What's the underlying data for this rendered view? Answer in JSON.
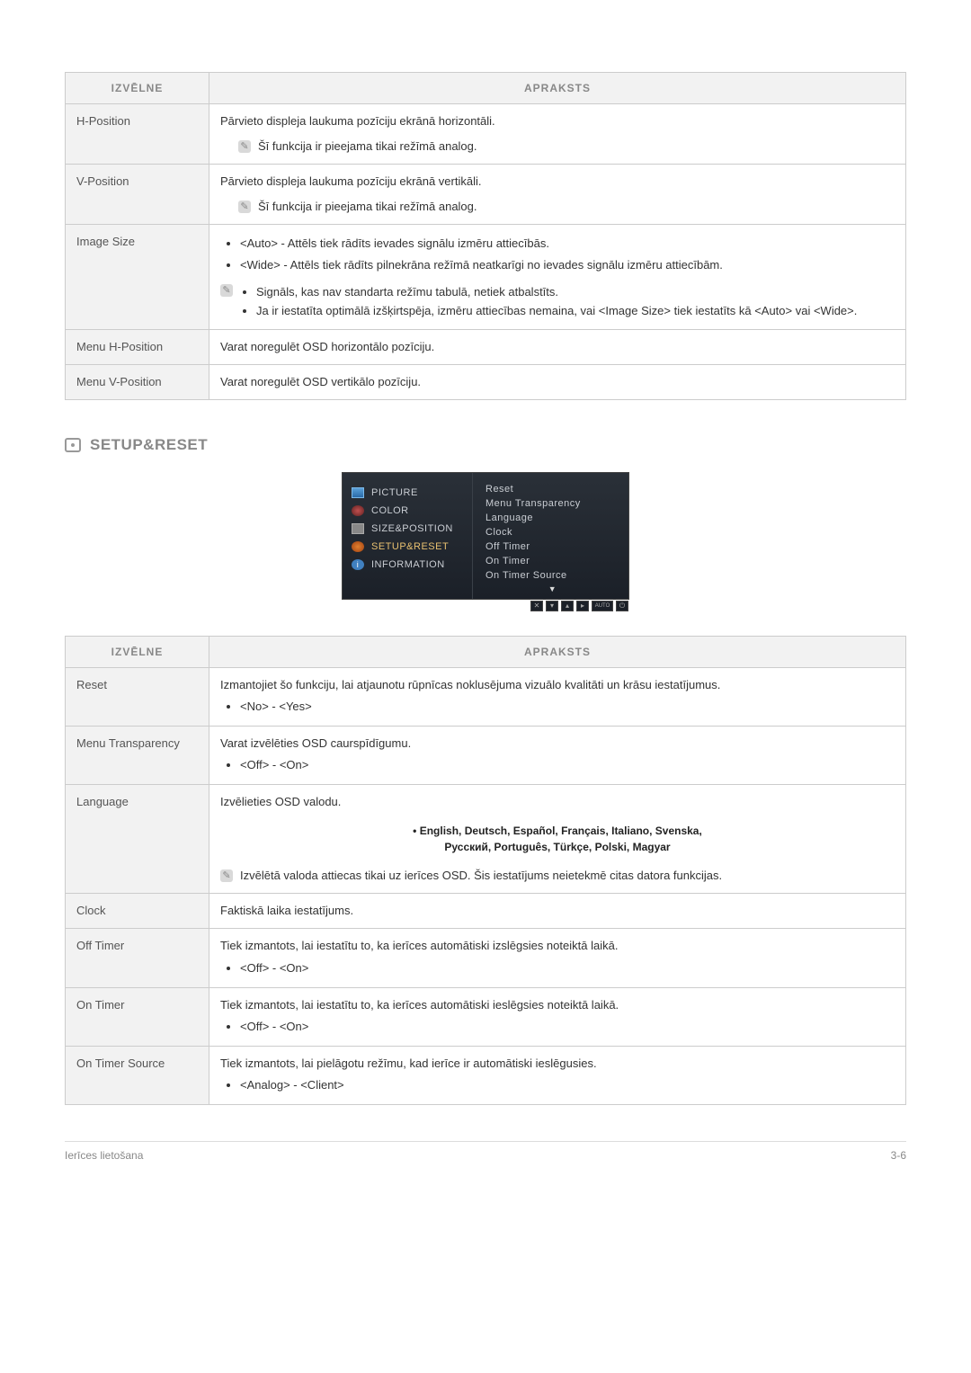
{
  "headers": {
    "menu": "IZVĒLNE",
    "desc": "APRAKSTS"
  },
  "table1": {
    "hposition": {
      "name": "H-Position",
      "desc": "Pārvieto displeja laukuma pozīciju ekrānā horizontāli.",
      "note": "Šī funkcija ir pieejama tikai režīmā analog."
    },
    "vposition": {
      "name": "V-Position",
      "desc": "Pārvieto displeja laukuma pozīciju ekrānā vertikāli.",
      "note": "Šī funkcija ir pieejama tikai režīmā analog."
    },
    "imagesize": {
      "name": "Image Size",
      "b1": "<Auto> - Attēls tiek rādīts ievades signālu izmēru attiecībās.",
      "b2": "<Wide> - Attēls tiek rādīts pilnekrāna režīmā neatkarīgi no ievades signālu izmēru attiecībām.",
      "n1": "Signāls, kas nav standarta režīmu tabulā, netiek atbalstīts.",
      "n2": "Ja ir iestatīta optimālā izšķirtspēja, izmēru attiecības nemaina, vai <Image Size> tiek iestatīts kā <Auto> vai <Wide>."
    },
    "menuH": {
      "name": "Menu H-Position",
      "desc": "Varat noregulēt OSD horizontālo pozīciju."
    },
    "menuV": {
      "name": "Menu V-Position",
      "desc": "Varat noregulēt OSD vertikālo pozīciju."
    }
  },
  "section": {
    "title": "SETUP&RESET"
  },
  "osd": {
    "left": {
      "picture": "PICTURE",
      "color": "COLOR",
      "size": "SIZE&POSITION",
      "setup": "SETUP&RESET",
      "info": "INFORMATION"
    },
    "right": {
      "reset": "Reset",
      "mtrans": "Menu Transparency",
      "lang": "Language",
      "clock": "Clock",
      "offt": "Off Timer",
      "ont": "On Timer",
      "onts": "On Timer Source"
    },
    "bottom": [
      "✕",
      "▾",
      "▴",
      "▸",
      "AUTO",
      "⏻"
    ]
  },
  "table2": {
    "reset": {
      "name": "Reset",
      "desc": "Izmantojiet šo funkciju, lai atjaunotu rūpnīcas noklusējuma vizuālo kvalitāti un krāsu iestatījumus.",
      "opt": "<No> - <Yes>"
    },
    "mtrans": {
      "name": "Menu Transparency",
      "desc": "Varat izvēlēties OSD caurspīdīgumu.",
      "opt": "<Off> - <On>"
    },
    "lang": {
      "name": "Language",
      "desc": "Izvēlieties OSD valodu.",
      "langs1": "English, Deutsch, Español, Français, Italiano, Svenska,",
      "langs2": "Русский, Português, Türkçe, Polski, Magyar",
      "note": "Izvēlētā valoda attiecas tikai uz ierīces OSD. Šis iestatījums neietekmē citas datora funkcijas."
    },
    "clock": {
      "name": "Clock",
      "desc": "Faktiskā laika iestatījums."
    },
    "offt": {
      "name": "Off Timer",
      "desc": "Tiek izmantots, lai iestatītu to, ka ierīces automātiski izslēgsies noteiktā laikā.",
      "opt": "<Off> - <On>"
    },
    "ont": {
      "name": "On Timer",
      "desc": "Tiek izmantots, lai iestatītu to, ka ierīces automātiski ieslēgsies noteiktā laikā.",
      "opt": "<Off> - <On>"
    },
    "onts": {
      "name": "On Timer Source",
      "desc": "Tiek izmantots, lai pielāgotu režīmu, kad ierīce ir automātiski ieslēgusies.",
      "opt": "<Analog> - <Client>"
    }
  },
  "footer": {
    "left": "Ierīces lietošana",
    "right": "3-6"
  }
}
